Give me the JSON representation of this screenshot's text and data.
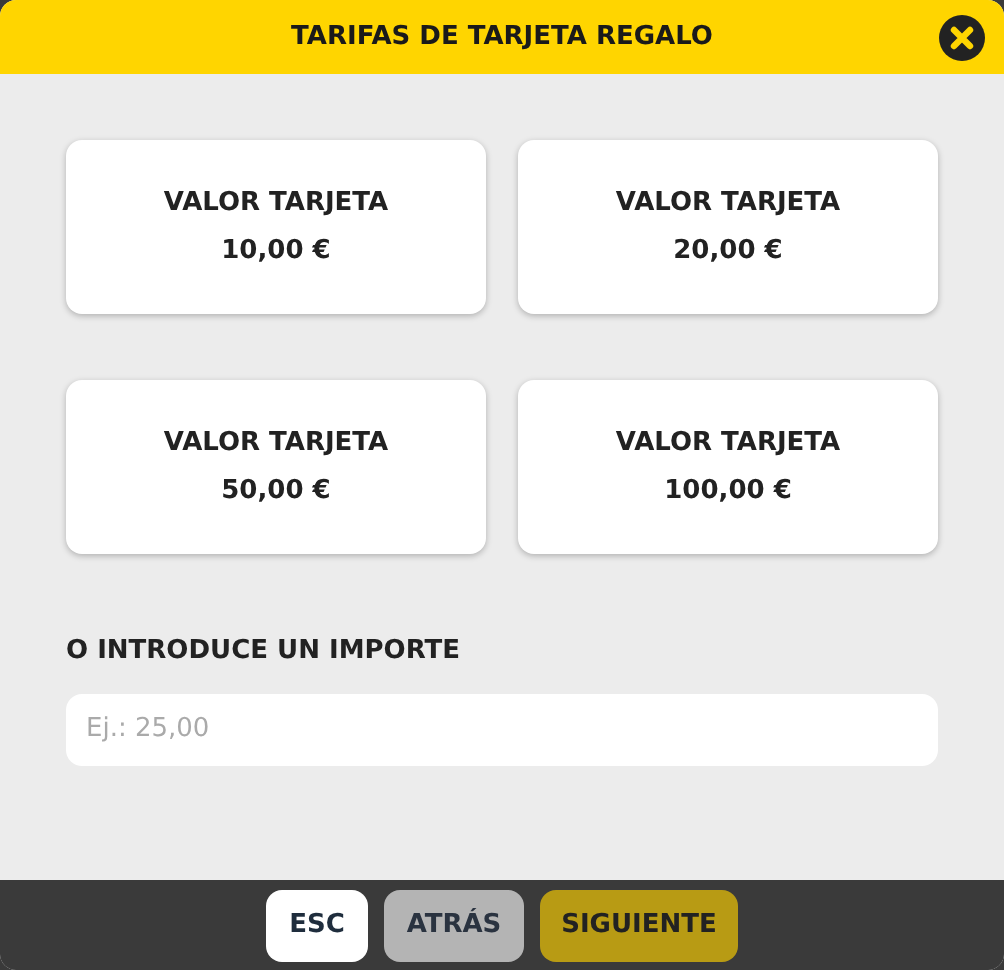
{
  "dialog": {
    "title": "TARIFAS DE TARJETA REGALO"
  },
  "options": [
    {
      "label": "VALOR TARJETA",
      "amount": "10,00 €"
    },
    {
      "label": "VALOR TARJETA",
      "amount": "20,00 €"
    },
    {
      "label": "VALOR TARJETA",
      "amount": "50,00 €"
    },
    {
      "label": "VALOR TARJETA",
      "amount": "100,00 €"
    }
  ],
  "custom_amount": {
    "label": "O INTRODUCE UN IMPORTE",
    "placeholder": "Ej.: 25,00"
  },
  "buttons": [
    {
      "label": "ESC",
      "kind": "plain"
    },
    {
      "label": "ATRÁS",
      "kind": "muted"
    },
    {
      "label": "SIGUIENTE",
      "kind": "primary"
    }
  ]
}
